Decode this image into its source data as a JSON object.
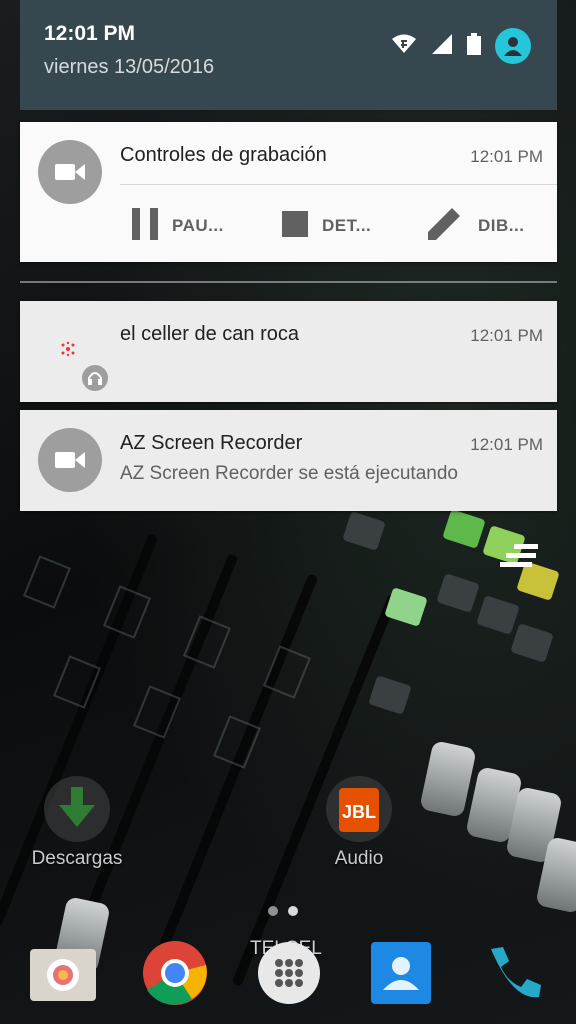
{
  "status_bar": {
    "time": "12:01 PM",
    "date": "viernes 13/05/2016"
  },
  "notifications": [
    {
      "id": "recording-controls",
      "title": "Controles de grabación",
      "time": "12:01 PM",
      "icon": "video-camera-icon",
      "actions": [
        {
          "label": "PAU...",
          "icon": "pause-icon"
        },
        {
          "label": "DET...",
          "icon": "stop-icon"
        },
        {
          "label": "DIB...",
          "icon": "pencil-icon"
        }
      ]
    },
    {
      "id": "song",
      "title": "el celler de can roca",
      "time": "12:01 PM",
      "icon": "music-app-icon",
      "badge_icon": "headphones-icon"
    },
    {
      "id": "az-recorder",
      "title": "AZ Screen Recorder",
      "text": "AZ Screen Recorder se está ejecutando",
      "time": "12:01 PM",
      "icon": "video-camera-icon"
    }
  ],
  "home": {
    "apps": [
      {
        "label": "Descargas",
        "icon": "download-arrow-icon"
      },
      {
        "label": "Audio",
        "icon": "jbl-speaker-icon"
      }
    ],
    "carrier": "TELCEL",
    "dock": [
      "camera-icon",
      "chrome-icon",
      "app-drawer-icon",
      "contacts-icon",
      "phone-icon"
    ]
  },
  "colors": {
    "shade_header": "#37474f",
    "avatar": "#26c6da",
    "card": "#fafafa",
    "icon_circle": "#9e9e9e"
  }
}
